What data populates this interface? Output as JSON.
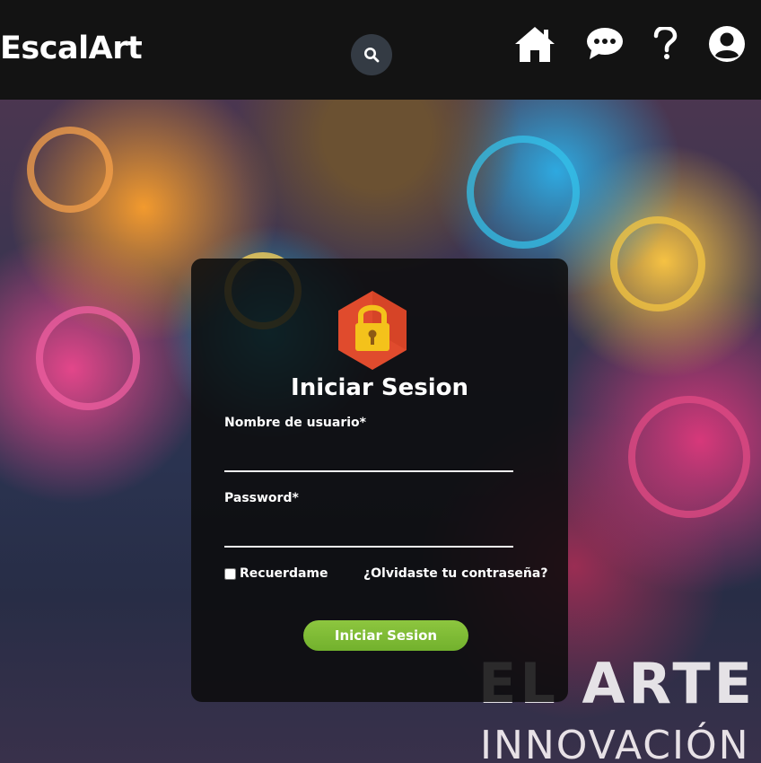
{
  "nav": {
    "brand": "EscalArt",
    "icons": [
      "search-icon",
      "home-icon",
      "chat-icon",
      "help-icon",
      "user-icon"
    ]
  },
  "hero": {
    "headline": "EL ARTE DE",
    "subheadline": "INNOVACIÓN T"
  },
  "login": {
    "title": "Iniciar Sesion",
    "username_label": "Nombre de usuario*",
    "username_value": "",
    "password_label": "Password*",
    "password_value": "",
    "remember_label": "Recuerdame",
    "remember_checked": false,
    "forgot_link": "¿Olvidaste tu contraseña?",
    "submit_label": "Iniciar Sesion"
  },
  "colors": {
    "navbar": "#131313",
    "search_button": "#343b44",
    "submit_button": "#7bb536",
    "lock_badge": "#e04b2d",
    "lock_icon": "#f4c21b"
  }
}
